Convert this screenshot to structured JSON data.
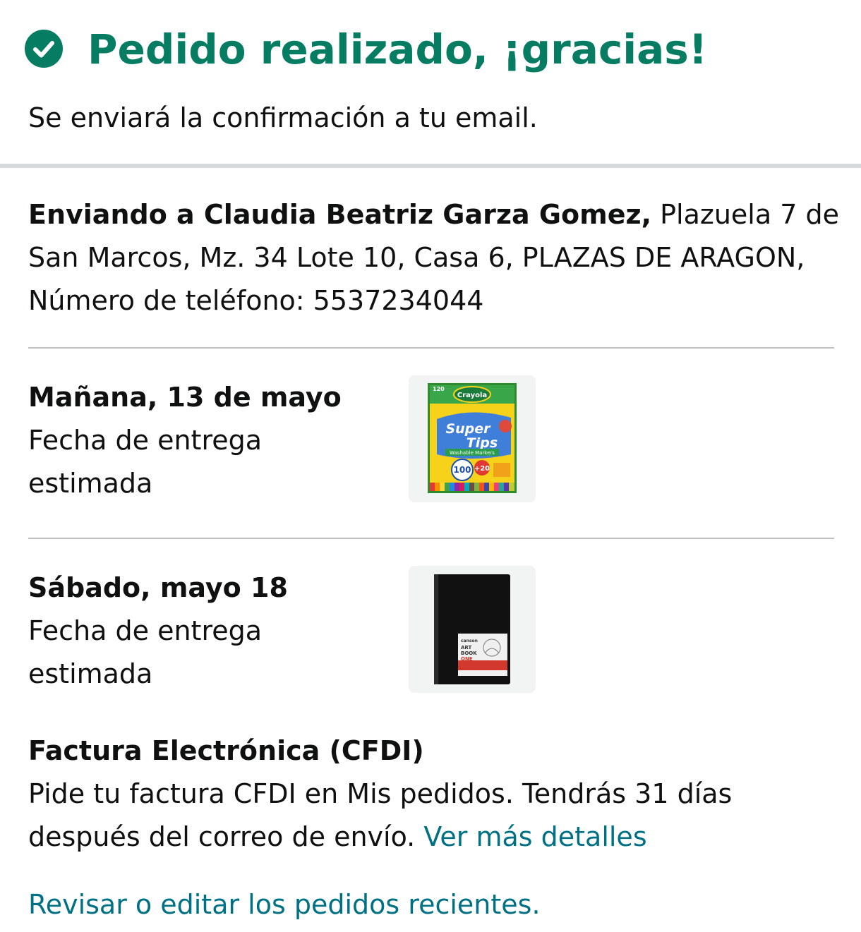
{
  "header": {
    "title": "Pedido realizado, ¡gracias!",
    "subtitle": "Se enviará la confirmación a tu email.",
    "icon": "check-circle-icon",
    "accent_color": "#067d62"
  },
  "shipping": {
    "prefix": "Enviando a Claudia Beatriz Garza Gomez,",
    "address": " Plazuela 7 de San Marcos, Mz. 34 Lote 10, Casa 6, PLAZAS DE ARAGON, Número de teléfono: 5537234044"
  },
  "deliveries": [
    {
      "date": "Mañana, 13 de mayo",
      "label": "Fecha de entrega estimada",
      "product_image": "crayola-super-tips-markers-box",
      "product_text": {
        "count": "120",
        "brand": "Crayola",
        "line1": "Super",
        "line2": "Tips",
        "sub": "Washable Markers",
        "colors": "100",
        "extra": "+20"
      }
    },
    {
      "date": "Sábado, mayo 18",
      "label": "Fecha de entrega estimada",
      "product_image": "canson-art-book-sketchbook",
      "product_text": {
        "brand": "canson",
        "line1": "ART",
        "line2": "BOOK",
        "line3": "ONE"
      }
    }
  ],
  "cfdi": {
    "heading": "Factura Electrónica (CFDI)",
    "text": "Pide tu factura CFDI en Mis pedidos. Tendrás 31 días después del correo de envío. ",
    "link": "Ver más detalles"
  },
  "recent_orders_link": "Revisar o editar los pedidos recientes.",
  "link_color": "#007185"
}
